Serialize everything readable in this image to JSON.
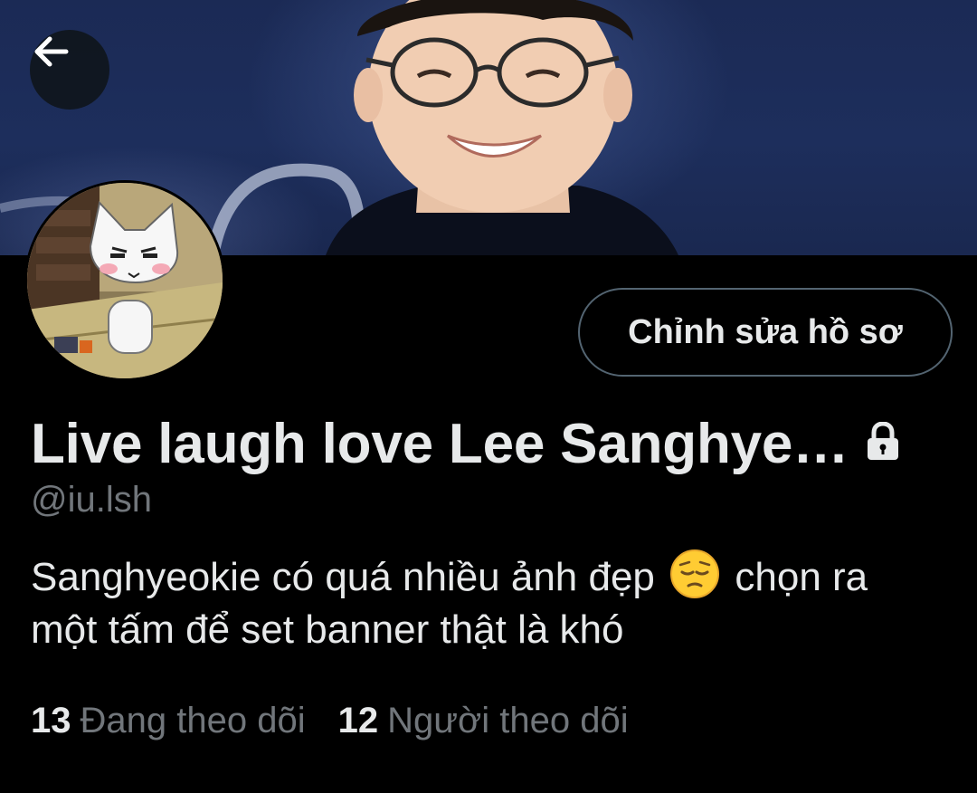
{
  "profile": {
    "display_name": "Live laugh love Lee Sanghye…",
    "handle": "@iu.lsh",
    "bio_part1": "Sanghyeokie có quá nhiều ảnh đẹp",
    "bio_part2": "chọn ra một tấm để set banner thật là khó",
    "bio_emoji": "pensive-face-emoji",
    "locked_icon": "lock-icon"
  },
  "actions": {
    "edit_profile_label": "Chỉnh sửa hồ sơ",
    "back_icon": "back-arrow-icon"
  },
  "stats": {
    "following_count": "13",
    "following_label": "Đang theo dõi",
    "followers_count": "12",
    "followers_label": "Người theo dõi"
  },
  "colors": {
    "background": "#000000",
    "primary_text": "#e7e9ea",
    "secondary_text": "#71767b",
    "button_border": "#536471",
    "banner_blue": "#1d2e5c"
  }
}
